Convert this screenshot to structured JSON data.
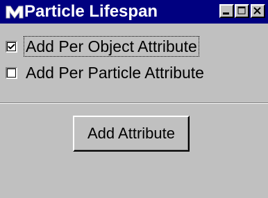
{
  "window": {
    "title": "Particle Lifespan",
    "icon": "maya-m-icon",
    "controls": [
      "minimize-icon",
      "maximize-icon",
      "close-icon"
    ]
  },
  "options": [
    {
      "label": "Add Per Object Attribute",
      "checked": true,
      "focused": true
    },
    {
      "label": "Add Per Particle Attribute",
      "checked": false,
      "focused": false
    }
  ],
  "actions": {
    "add_attribute_label": "Add Attribute"
  },
  "colors": {
    "titlebar": "#000080",
    "face": "#c0c0c0"
  }
}
